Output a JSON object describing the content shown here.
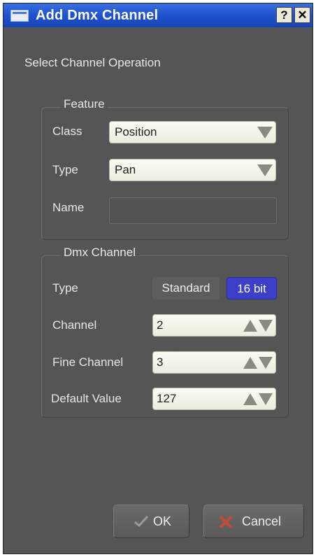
{
  "window": {
    "title": "Add Dmx Channel",
    "help_glyph": "?",
    "close_glyph": "✕"
  },
  "heading": "Select Channel Operation",
  "feature": {
    "legend": "Feature",
    "class_label": "Class",
    "class_value": "Position",
    "type_label": "Type",
    "type_value": "Pan",
    "name_label": "Name",
    "name_value": ""
  },
  "dmx": {
    "legend": "Dmx Channel",
    "type_label": "Type",
    "type_options": [
      "Standard",
      "16 bit"
    ],
    "type_selected": "16 bit",
    "channel_label": "Channel",
    "channel_value": "2",
    "fine_channel_label": "Fine Channel",
    "fine_channel_value": "3",
    "default_value_label": "Default Value",
    "default_value": "127"
  },
  "buttons": {
    "ok": "OK",
    "cancel": "Cancel"
  },
  "icons": {
    "app": "window-icon",
    "ok": "checkmark-icon",
    "cancel": "cross-icon"
  },
  "colors": {
    "titlebar": "#1f52cf",
    "window_bg": "#555555",
    "selected_segment": "#3b3fc9"
  }
}
